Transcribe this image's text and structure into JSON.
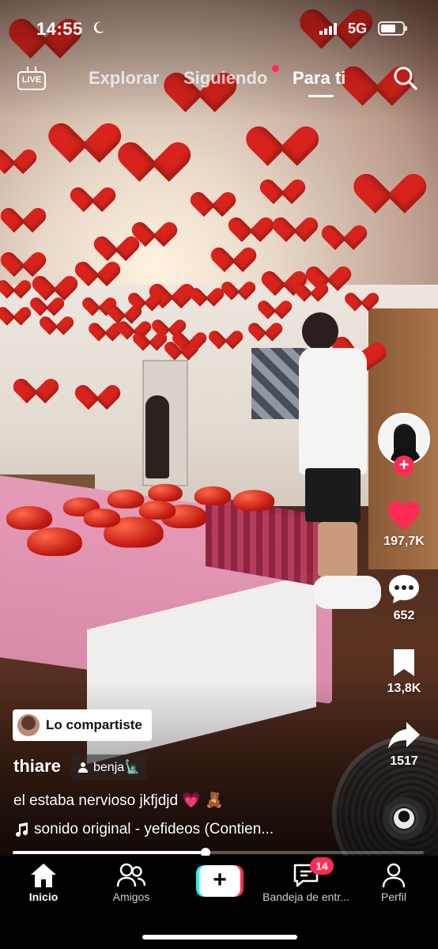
{
  "status_bar": {
    "time": "14:55",
    "network": "5G",
    "battery_level": 0.7,
    "icons": [
      "moon-icon",
      "signal-icon",
      "battery-icon"
    ]
  },
  "top_nav": {
    "live_label": "LIVE",
    "tabs": [
      {
        "label": "Explorar",
        "active": false
      },
      {
        "label": "Siguiendo",
        "active": false,
        "has_dot": true
      },
      {
        "label": "Para ti",
        "active": true
      }
    ],
    "icons": [
      "live-icon",
      "search-icon"
    ]
  },
  "rail": {
    "follow_symbol": "+",
    "likes": "197,7K",
    "comments": "652",
    "saves": "13,8K",
    "shares": "1517"
  },
  "post": {
    "shared_label": "Lo compartiste",
    "username": "thiare",
    "tagged_user": "benja🗽",
    "caption": "el estaba nervioso jkfjdjd 💗 🧸",
    "sound": "sonido original - yefideos (Contien..."
  },
  "progress": {
    "played_fraction": 0.47
  },
  "bottom_nav": {
    "items": [
      {
        "label": "Inicio",
        "active": true
      },
      {
        "label": "Amigos",
        "active": false
      },
      {
        "label": "",
        "active": false
      },
      {
        "label": "Bandeja de entr...",
        "active": false,
        "badge": "14"
      },
      {
        "label": "Perfil",
        "active": false
      }
    ],
    "create_symbol": "+"
  },
  "colors": {
    "accent_red": "#fe2c55",
    "accent_cyan": "#25f4ee",
    "balloon_red": "#d8231c"
  }
}
